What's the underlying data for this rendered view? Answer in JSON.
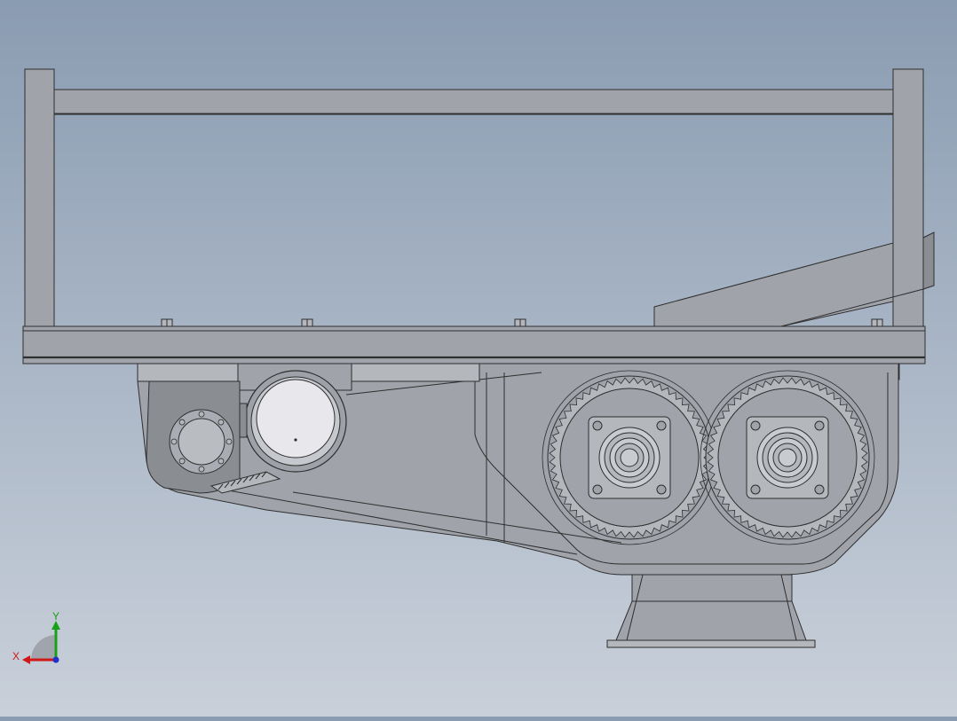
{
  "viewport": {
    "background_top": "#8a9cb2",
    "background_bottom": "#c9d0da"
  },
  "colors": {
    "steel": "#a0a4aa",
    "steel_light": "#b4b7bc",
    "steel_dark": "#8a8d92",
    "edge": "#2e2e2e",
    "motor_face": "#e8e8ec"
  },
  "triad": {
    "x_label": "X",
    "y_label": "Y",
    "x_color": "#d01818",
    "y_color": "#18a018",
    "z_color": "#2030c8"
  },
  "assembly": {
    "roller_count": 2,
    "roller_teeth": 56,
    "motor_count": 1
  }
}
